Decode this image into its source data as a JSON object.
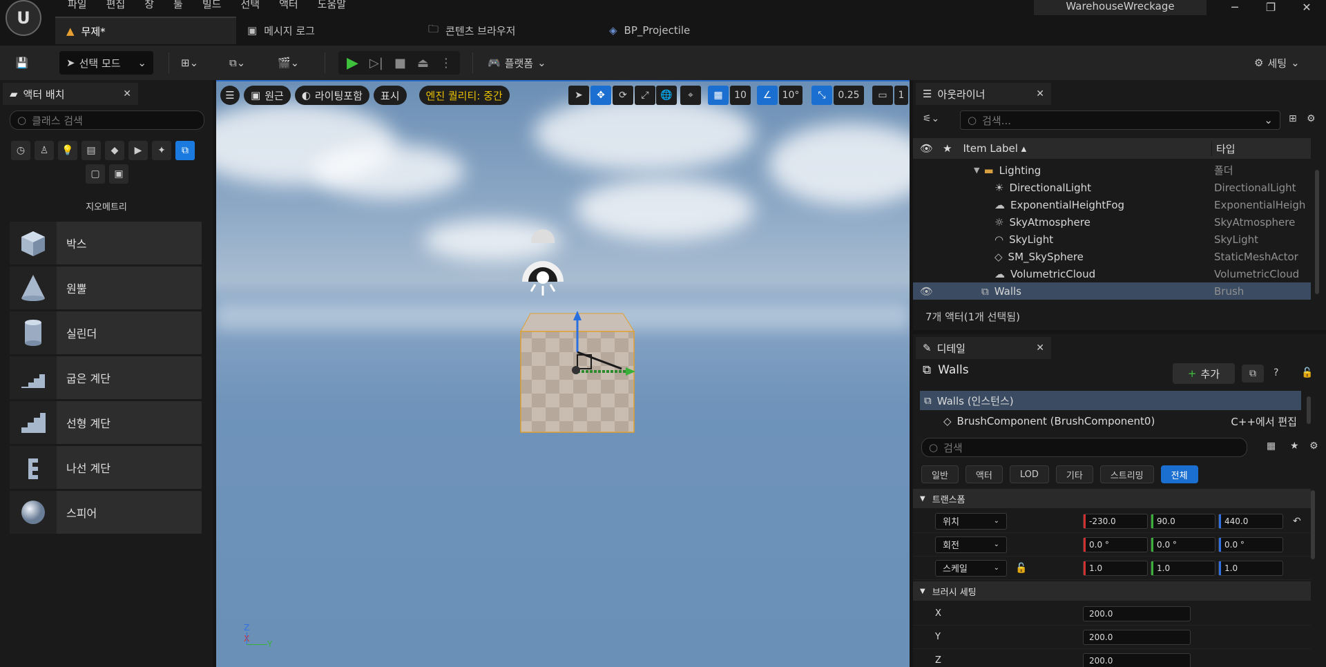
{
  "app": {
    "project_name": "WarehouseWreckage",
    "menu": [
      "파일",
      "편집",
      "창",
      "툴",
      "빌드",
      "선택",
      "액터",
      "도움말"
    ],
    "tabs": [
      {
        "label": "무제*",
        "icon": "level-icon"
      },
      {
        "label": "메시지 로그",
        "icon": "message-log-icon"
      },
      {
        "label": "콘텐츠 브라우저",
        "icon": "content-browser-icon"
      },
      {
        "label": "BP_Projectile",
        "icon": "blueprint-icon"
      }
    ]
  },
  "toolbar": {
    "mode_label": "선택 모드",
    "platform_label": "플랫폼",
    "settings_label": "세팅"
  },
  "place_actors": {
    "tab_label": "액터 배치",
    "search_placeholder": "클래스 검색",
    "category_label": "지오메트리",
    "items": [
      "박스",
      "원뿔",
      "실린더",
      "굽은 계단",
      "선형 계단",
      "나선 계단",
      "스피어"
    ]
  },
  "viewport": {
    "perspective_label": "원근",
    "lighting_label": "라이팅포함",
    "show_label": "표시",
    "quality_label": "엔진 퀄리티: 중간",
    "grid_snap": "10",
    "rotation_snap": "10°",
    "scale_snap": "0.25",
    "camera_speed": "1",
    "axis_labels": {
      "z": "Z",
      "x": "X",
      "y": "Y"
    }
  },
  "outliner": {
    "tab_label": "아웃라이너",
    "search_placeholder": "검색...",
    "col_label": "Item Label ▴",
    "col_type": "타입",
    "rows": [
      {
        "name": "Lighting",
        "type": "폴더"
      },
      {
        "name": "DirectionalLight",
        "type": "DirectionalLight"
      },
      {
        "name": "ExponentialHeightFog",
        "type": "ExponentialHeigh"
      },
      {
        "name": "SkyAtmosphere",
        "type": "SkyAtmosphere"
      },
      {
        "name": "SkyLight",
        "type": "SkyLight"
      },
      {
        "name": "SM_SkySphere",
        "type": "StaticMeshActor"
      },
      {
        "name": "VolumetricCloud",
        "type": "VolumetricCloud"
      },
      {
        "name": "Walls",
        "type": "Brush"
      }
    ],
    "status": "7개 액터(1개 선택됨)"
  },
  "details": {
    "tab_label": "디테일",
    "actor_name": "Walls",
    "add_label": "추가",
    "instance_label": "Walls (인스턴스)",
    "component_label": "BrushComponent (BrushComponent0)",
    "component_edit": "C++에서 편집",
    "search_placeholder": "검색",
    "filters": [
      "일반",
      "액터",
      "LOD",
      "기타",
      "스트리밍",
      "전체"
    ],
    "transform_section": "트랜스폼",
    "location_label": "위치",
    "rotation_label": "회전",
    "scale_label": "스케일",
    "location": [
      "-230.0",
      "90.0",
      "440.0"
    ],
    "rotation": [
      "0.0 °",
      "0.0 °",
      "0.0 °"
    ],
    "scale": [
      "1.0",
      "1.0",
      "1.0"
    ],
    "brush_section": "브러시 세팅",
    "brush": [
      {
        "label": "X",
        "value": "200.0"
      },
      {
        "label": "Y",
        "value": "200.0"
      },
      {
        "label": "Z",
        "value": "200.0"
      }
    ]
  }
}
